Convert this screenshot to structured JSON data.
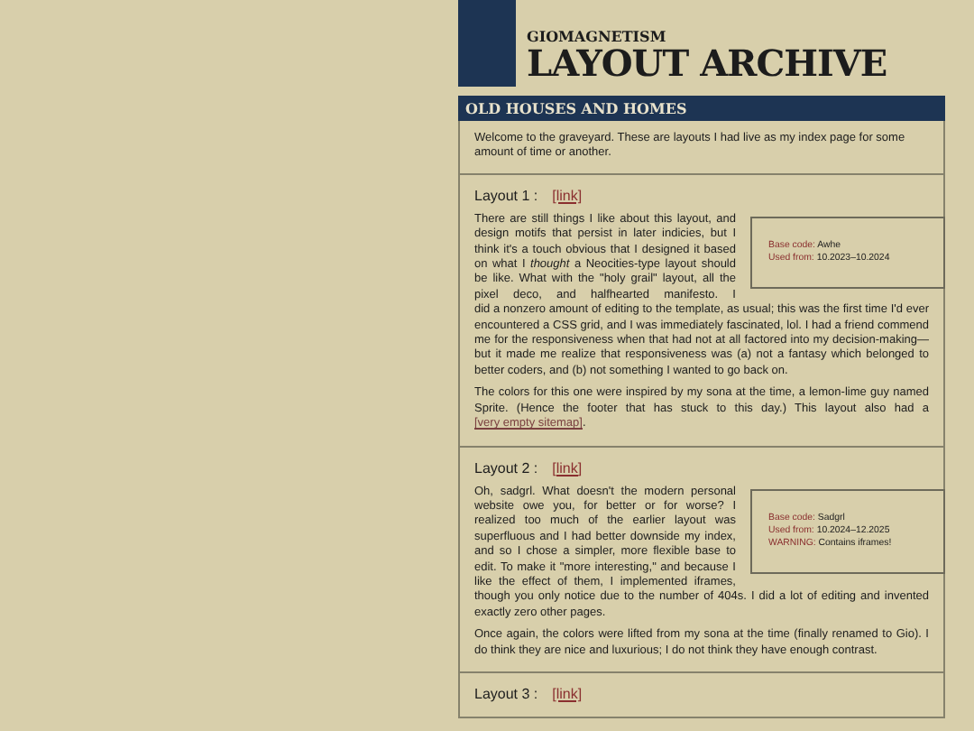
{
  "header": {
    "kicker": "GIOMAGNETISM",
    "title": "LAYOUT ARCHIVE"
  },
  "section_title": "OLD HOUSES AND HOMES",
  "intro": "Welcome to the graveyard. These are layouts I had live as my index page for some amount of time or another.",
  "layouts": [
    {
      "heading": "Layout 1 :",
      "link": "[link]",
      "info": [
        {
          "label": "Base code:",
          "value": "Awhe"
        },
        {
          "label": "Used from:",
          "value": "10.2023–10.2024"
        }
      ],
      "beside": "There are still things I like about this layout, and design motifs that persist in later indicies, but I think it's a touch obvious that I designed it based on what I *thought* a Neocities-type layout should be like. What with the \"holy grail\" layout, all the pixel deco, and halfhearted manifesto. I",
      "paragraphs": [
        {
          "text": "did a nonzero amount of editing to the template, as usual; this was the first time I'd ever encountered a CSS grid, and I was immediately fascinated, lol. I had a friend commend me for the responsiveness when that had not at all factored into my decision-making—but it made me realize that responsiveness was (a) not a fantasy which belonged to better coders, and (b) not something I wanted to go back on."
        },
        {
          "text": "The colors for this one were inspired by my sona at the time, a lemon-lime guy named Sprite. (Hence the footer that has stuck to this day.) This layout also had a",
          "link": "[very empty sitemap]",
          "end": "."
        }
      ]
    },
    {
      "heading": "Layout 2 :",
      "link": "[link]",
      "info": [
        {
          "label": "Base code:",
          "value": "Sadgrl"
        },
        {
          "label": "Used from:",
          "value": "10.2024–12.2025"
        },
        {
          "label": "WARNING:",
          "value": "Contains iframes!"
        }
      ],
      "beside": "Oh, sadgrl. What doesn't the modern personal website owe you, for better or for worse? I realized too much of the earlier layout was superfluous and I had better downside my index, and so I chose a simpler, more flexible base to edit. To make it \"more interesting,\" and because I like the effect of them, I implemented iframes,",
      "paragraphs": [
        {
          "text": "though you only notice due to the number of 404s. I did a lot of editing and invented exactly zero other pages."
        },
        {
          "text": "Once again, the colors were lifted from my sona at the time (finally renamed to Gio). I do think they are nice and luxurious; I do not think they have enough contrast."
        }
      ]
    },
    {
      "heading": "Layout 3 :",
      "link": "[link]"
    }
  ]
}
